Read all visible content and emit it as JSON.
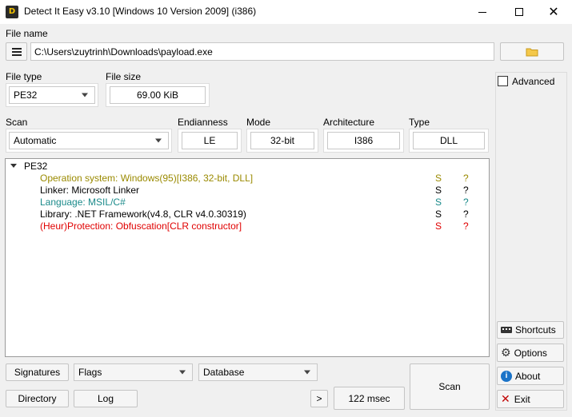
{
  "window": {
    "title": "Detect It Easy v3.10 [Windows 10 Version 2009] (i386)",
    "icon_text": "D"
  },
  "file": {
    "label": "File name",
    "path": "C:\\Users\\zuytrinh\\Downloads\\payload.exe"
  },
  "file_type": {
    "label": "File type",
    "value": "PE32"
  },
  "file_size": {
    "label": "File size",
    "value": "69.00 KiB"
  },
  "scan": {
    "label": "Scan",
    "value": "Automatic"
  },
  "endianness": {
    "label": "Endianness",
    "value": "LE"
  },
  "mode": {
    "label": "Mode",
    "value": "32-bit"
  },
  "architecture": {
    "label": "Architecture",
    "value": "I386"
  },
  "type": {
    "label": "Type",
    "value": "DLL"
  },
  "tree": {
    "root": "PE32",
    "rows": [
      {
        "text": "Operation system: Windows(95)[I386, 32-bit, DLL]",
        "color": "#9a8a00",
        "s": "S",
        "q": "?"
      },
      {
        "text": "Linker: Microsoft Linker",
        "color": "#000000",
        "s": "S",
        "q": "?"
      },
      {
        "text": "Language: MSIL/C#",
        "color": "#1a8a8a",
        "s": "S",
        "q": "?"
      },
      {
        "text": "Library: .NET Framework(v4.8, CLR v4.0.30319)",
        "color": "#000000",
        "s": "S",
        "q": "?"
      },
      {
        "text": "(Heur)Protection: Obfuscation[CLR constructor]",
        "color": "#e00000",
        "s": "S",
        "q": "?"
      }
    ]
  },
  "advanced": {
    "label": "Advanced",
    "checked": false
  },
  "side_buttons": {
    "shortcuts": "Shortcuts",
    "options": "Options",
    "about": "About",
    "exit": "Exit"
  },
  "bottom": {
    "signatures": "Signatures",
    "flags": "Flags",
    "database": "Database",
    "directory": "Directory",
    "log": "Log",
    "more": ">",
    "time": "122 msec",
    "scan_button": "Scan"
  },
  "icons": {
    "menu": "list-icon",
    "folder": "folder-icon",
    "shortcuts": "keyboard-icon",
    "options": "gear-icon",
    "about": "info-icon",
    "exit": "close-icon"
  }
}
